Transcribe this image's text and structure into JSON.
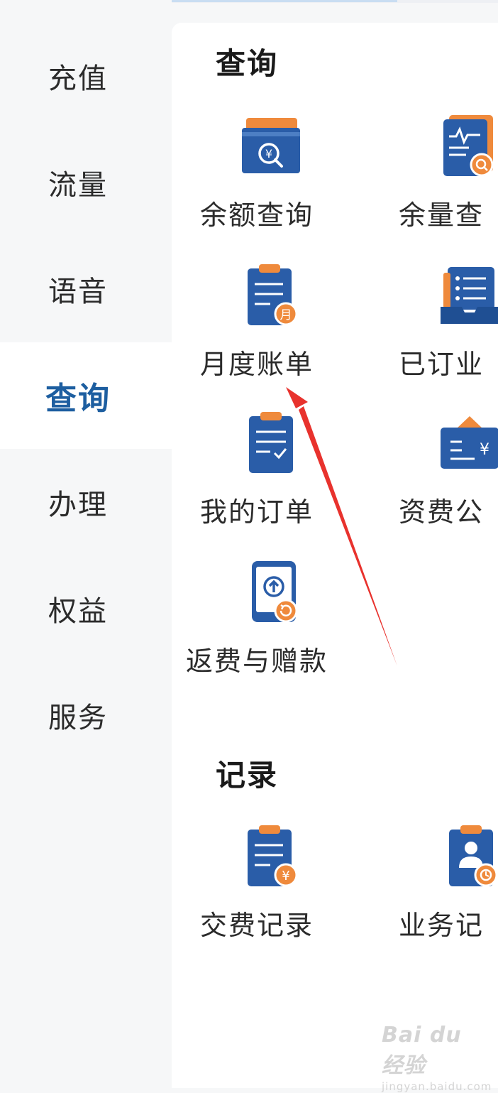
{
  "sidebar": {
    "items": [
      {
        "label": "充值"
      },
      {
        "label": "流量"
      },
      {
        "label": "语音"
      },
      {
        "label": "查询",
        "active": true
      },
      {
        "label": "办理"
      },
      {
        "label": "权益"
      },
      {
        "label": "服务"
      }
    ]
  },
  "sections": {
    "query": {
      "title": "查询",
      "tiles": [
        {
          "label": "余额查询",
          "icon": "balance-query-icon"
        },
        {
          "label": "余量查",
          "icon": "usage-query-icon"
        },
        {
          "label": "月度账单",
          "icon": "monthly-bill-icon"
        },
        {
          "label": "已订业",
          "icon": "subscribed-services-icon"
        },
        {
          "label": "我的订单",
          "icon": "my-orders-icon"
        },
        {
          "label": "资费公",
          "icon": "tariff-notice-icon"
        },
        {
          "label": "返费与赠款",
          "icon": "refund-bonus-icon"
        }
      ]
    },
    "records": {
      "title": "记录",
      "tiles": [
        {
          "label": "交费记录",
          "icon": "payment-record-icon"
        },
        {
          "label": "业务记",
          "icon": "business-record-icon"
        }
      ]
    }
  },
  "watermark": {
    "logo": "Bai du 经验",
    "sub": "jingyan.baidu.com"
  },
  "colors": {
    "primary": "#2a5da8",
    "accent": "#ef8a3c",
    "active_text": "#1d5ea0",
    "annotation": "#e8322d"
  }
}
